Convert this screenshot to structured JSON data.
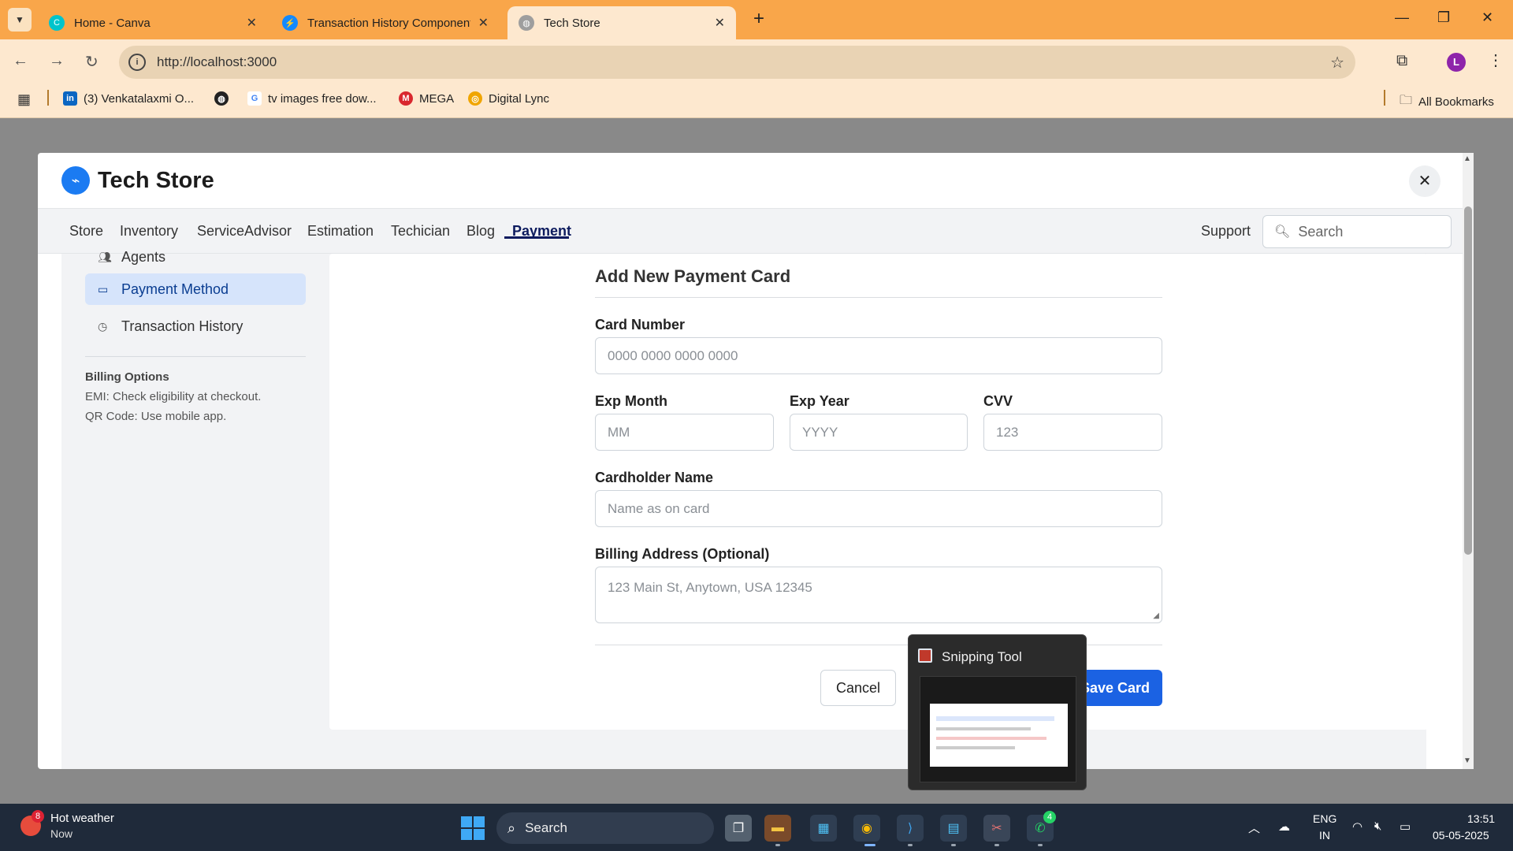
{
  "browser": {
    "tabs": [
      {
        "label": "Home - Canva",
        "icon": "canva-icon",
        "active": false
      },
      {
        "label": "Transaction History Component",
        "icon": "stackblitz-icon",
        "active": false
      },
      {
        "label": "Tech Store",
        "icon": "globe-icon",
        "active": true
      }
    ],
    "url": "http://localhost:3000",
    "profile_initial": "L",
    "bookmarks": [
      {
        "label": "(3) Venkatalaxmi O...",
        "icon": "linkedin-icon"
      },
      {
        "label": "",
        "icon": "globe-icon"
      },
      {
        "label": "tv images free dow...",
        "icon": "google-icon"
      },
      {
        "label": "MEGA",
        "icon": "mega-icon"
      },
      {
        "label": "Digital Lync",
        "icon": "digital-lync-icon"
      }
    ],
    "all_bookmarks": "All Bookmarks"
  },
  "app": {
    "brand": "Tech Store",
    "nav": [
      "Store",
      "Inventory",
      "ServiceAdvisor",
      "Estimation",
      "Techician",
      "Blog",
      "Payment"
    ],
    "active_nav": "Payment",
    "support": "Support",
    "search_placeholder": "Search"
  },
  "sidebar": {
    "items": [
      {
        "label": "Agents",
        "icon": "agents-icon"
      },
      {
        "label": "Payment Method",
        "icon": "card-icon",
        "active": true
      },
      {
        "label": "Transaction History",
        "icon": "clock-icon"
      }
    ],
    "billing_title": "Billing Options",
    "billing_lines": [
      "EMI: Check eligibility at checkout.",
      "QR Code: Use mobile app."
    ]
  },
  "form": {
    "title": "Add New Payment Card",
    "card_number": {
      "label": "Card Number",
      "placeholder": "0000 0000 0000 0000"
    },
    "exp_month": {
      "label": "Exp Month",
      "placeholder": "MM"
    },
    "exp_year": {
      "label": "Exp Year",
      "placeholder": "YYYY"
    },
    "cvv": {
      "label": "CVV",
      "placeholder": "123"
    },
    "cardholder": {
      "label": "Cardholder Name",
      "placeholder": "Name as on card"
    },
    "billing_address": {
      "label": "Billing Address (Optional)",
      "placeholder": "123 Main St, Anytown, USA 12345"
    },
    "cancel": "Cancel",
    "save": "Save Card"
  },
  "snipping_tool": {
    "title": "Snipping Tool"
  },
  "taskbar": {
    "weather_title": "Hot weather",
    "weather_sub": "Now",
    "weather_badge": "8",
    "search": "Search",
    "whatsapp_badge": "4",
    "lang_line1": "ENG",
    "lang_line2": "IN",
    "time": "13:51",
    "date": "05-05-2025"
  },
  "colors": {
    "tabbar": "#f9a64a",
    "primary": "#1b62e3",
    "active_nav": "#0d1b5e"
  }
}
